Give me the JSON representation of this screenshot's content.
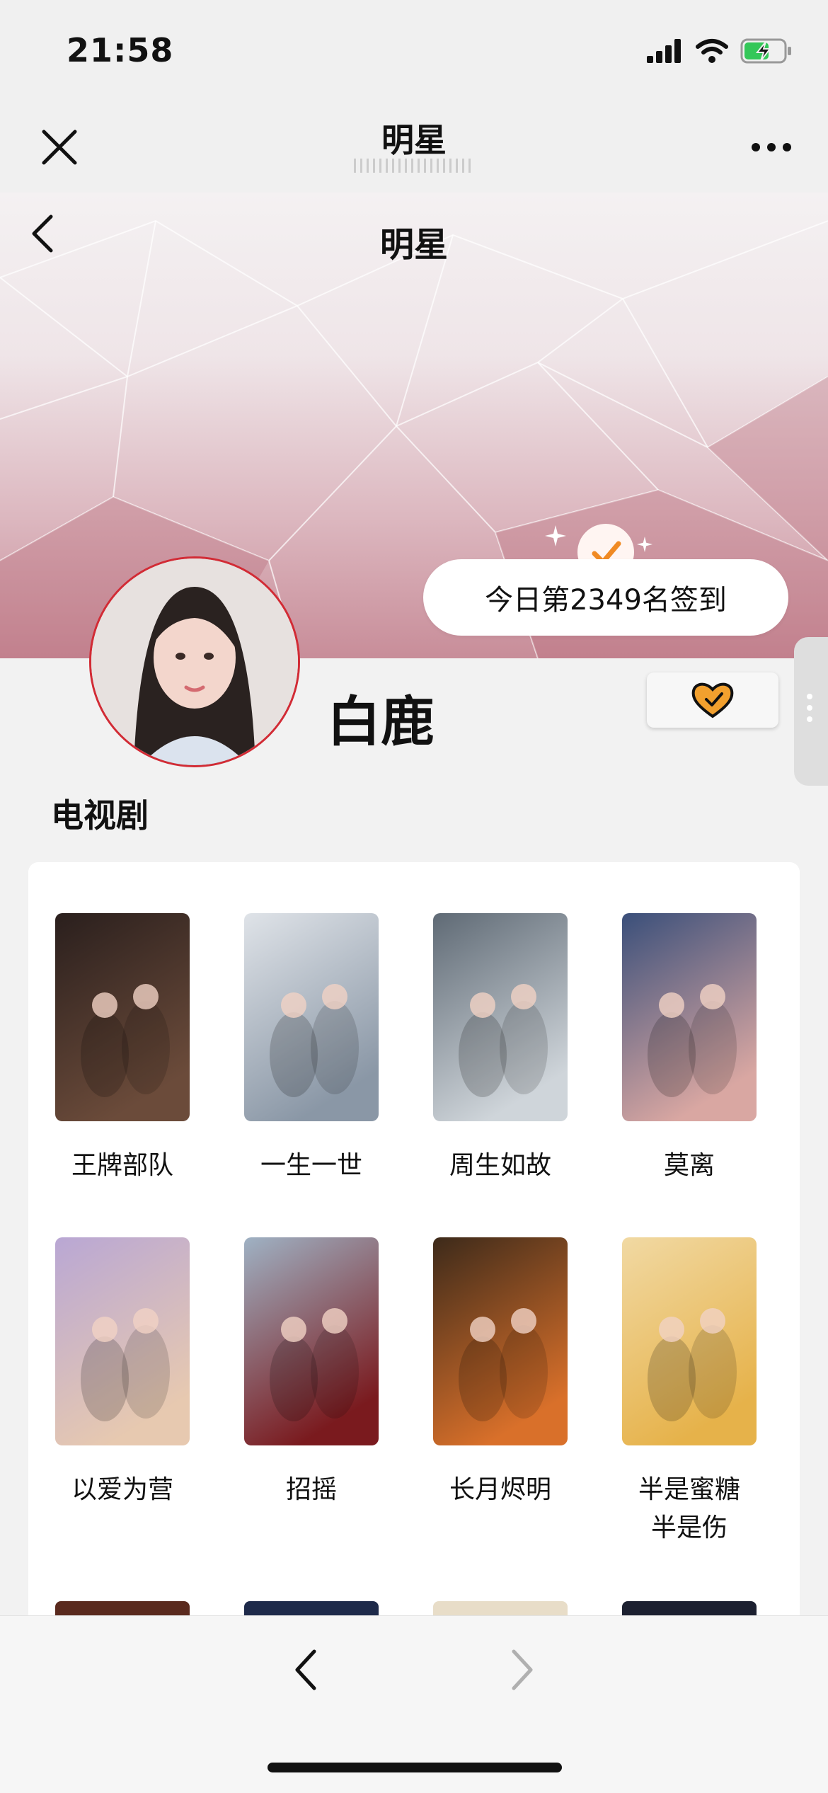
{
  "status_bar": {
    "time": "21:58",
    "icons": [
      "signal-icon",
      "wifi-icon",
      "battery-charging-icon"
    ]
  },
  "top_nav": {
    "title": "明星",
    "close_icon": "close-icon",
    "more_icon": "more-icon"
  },
  "hero": {
    "back_icon": "chevron-left-icon",
    "title": "明星"
  },
  "checkin": {
    "text": "今日第2349名签到",
    "icon": "check-icon"
  },
  "profile": {
    "name": "白鹿",
    "favorite_icon": "heart-check-icon"
  },
  "section": {
    "title": "电视剧"
  },
  "dramas": [
    {
      "title": "王牌部队",
      "colors": [
        "#2a1f1d",
        "#6b4b3a"
      ]
    },
    {
      "title": "一生一世",
      "colors": [
        "#dfe3e8",
        "#8a97a6"
      ]
    },
    {
      "title": "周生如故",
      "colors": [
        "#5f6a75",
        "#cfd5da"
      ]
    },
    {
      "title": "莫离",
      "colors": [
        "#3a4f7a",
        "#d9a7a2"
      ]
    },
    {
      "title": "以爱为营",
      "colors": [
        "#b9a7d4",
        "#e7c9b0"
      ]
    },
    {
      "title": "招摇",
      "colors": [
        "#9fb2c4",
        "#7a1a1e"
      ]
    },
    {
      "title": "长月烬明",
      "colors": [
        "#3d2a1a",
        "#d9702a"
      ]
    },
    {
      "title": "半是蜜糖半是伤",
      "colors": [
        "#f1d9a3",
        "#e6b24a"
      ]
    }
  ],
  "colors": {
    "accent": "#d22b35",
    "check_orange": "#f08a24",
    "hero_pink": "#c88d99"
  },
  "bottom_bar": {
    "back_icon": "chevron-left-icon",
    "forward_icon": "chevron-right-icon"
  }
}
